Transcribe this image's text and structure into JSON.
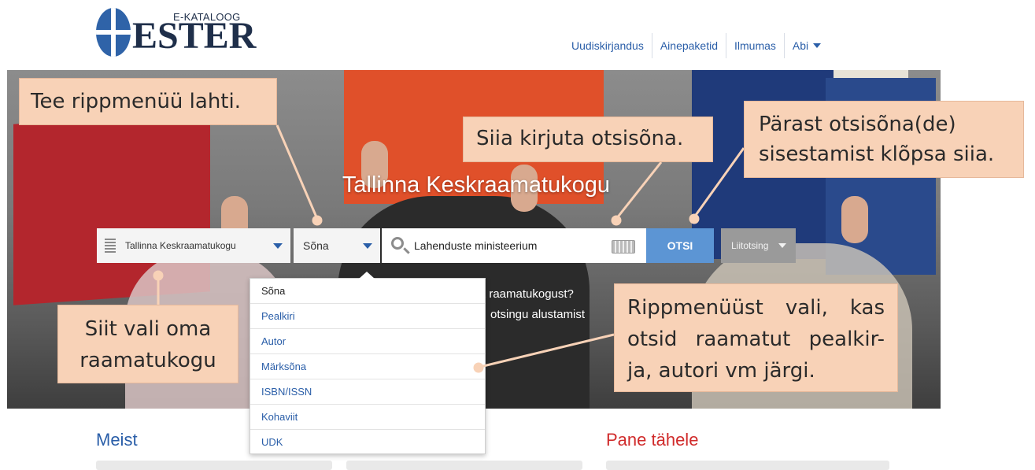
{
  "header": {
    "logo_sub": "E-KATALOOG",
    "logo_main": "ESTER",
    "nav": [
      {
        "label": "Uudiskirjandus"
      },
      {
        "label": "Ainepaketid"
      },
      {
        "label": "Ilmumas"
      },
      {
        "label": "Abi"
      }
    ]
  },
  "hero": {
    "title": "Tallinna Keskraamatukogu",
    "question_line1": "t raamatukogust?",
    "question_line2": "otsingu alustamist"
  },
  "search": {
    "library_select": "Tallinna Keskraamatukogu",
    "type_select": "Sõna",
    "query": "Lahenduste ministeerium",
    "submit_label": "OTSI",
    "advanced_label": "Liitotsing"
  },
  "dropdown": {
    "options": [
      "Sõna",
      "Pealkiri",
      "Autor",
      "Märksõna",
      "ISBN/ISSN",
      "Kohaviit",
      "UDK"
    ],
    "selected": "Sõna"
  },
  "callouts": {
    "open_dropdown": "Tee rippmenüü lahti.",
    "type_here": "Siia kirjuta otsisõna.",
    "click_here": "Pärast otsisõna(de) sisestamist klõpsa siia.",
    "choose_library": "Siit vali oma raamatukogu",
    "choose_field": "Rippmenüüst vali, kas otsid raamatut pealkir-ja, autori vm järgi."
  },
  "sections": {
    "about": "Meist",
    "notice": "Pane tähele"
  },
  "colors": {
    "brand_blue": "#2a5ea8",
    "search_button": "#5c95d4",
    "callout_bg": "#f8d2b7",
    "notice_red": "#d02b2b"
  }
}
